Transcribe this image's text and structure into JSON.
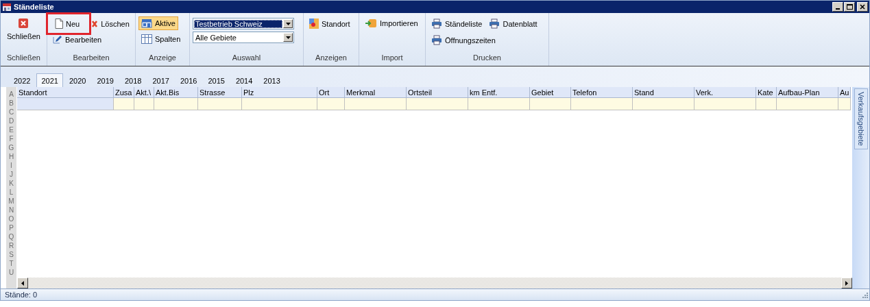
{
  "window": {
    "title": "Ständeliste"
  },
  "ribbon": {
    "groups": [
      {
        "label": "Schließen",
        "buttons": [
          {
            "label": "Schließen",
            "highlighted": false,
            "selected": false
          }
        ]
      },
      {
        "label": "Bearbeiten",
        "buttons": [
          {
            "label": "Neu",
            "highlighted": true,
            "selected": false
          },
          {
            "label": "Löschen",
            "highlighted": false,
            "selected": false
          },
          {
            "label": "Bearbeiten",
            "highlighted": false,
            "selected": false
          }
        ]
      },
      {
        "label": "Anzeige",
        "buttons": [
          {
            "label": "Aktive",
            "highlighted": false,
            "selected": true
          },
          {
            "label": "Spalten",
            "highlighted": false,
            "selected": false
          }
        ]
      },
      {
        "label": "Auswahl",
        "dropdowns": [
          {
            "value": "Testbetrieb Schweiz",
            "focused": true
          },
          {
            "value": "Alle Gebiete",
            "focused": false
          }
        ]
      },
      {
        "label": "Anzeigen",
        "buttons": [
          {
            "label": "Standort",
            "highlighted": false,
            "selected": false
          }
        ]
      },
      {
        "label": "Import",
        "buttons": [
          {
            "label": "Importieren",
            "highlighted": false,
            "selected": false
          }
        ]
      },
      {
        "label": "Drucken",
        "buttons": [
          {
            "label": "Ständeliste",
            "highlighted": false,
            "selected": false
          },
          {
            "label": "Datenblatt",
            "highlighted": false,
            "selected": false
          },
          {
            "label": "Öffnungszeiten",
            "highlighted": false,
            "selected": false
          }
        ]
      }
    ]
  },
  "year_tabs": [
    {
      "label": "2022",
      "selected": false
    },
    {
      "label": "2021",
      "selected": true
    },
    {
      "label": "2020",
      "selected": false
    },
    {
      "label": "2019",
      "selected": false
    },
    {
      "label": "2018",
      "selected": false
    },
    {
      "label": "2017",
      "selected": false
    },
    {
      "label": "2016",
      "selected": false
    },
    {
      "label": "2015",
      "selected": false
    },
    {
      "label": "2014",
      "selected": false
    },
    {
      "label": "2013",
      "selected": false
    }
  ],
  "row_letters": [
    "A",
    "B",
    "C",
    "D",
    "E",
    "F",
    "G",
    "H",
    "I",
    "J",
    "K",
    "L",
    "M",
    "N",
    "O",
    "P",
    "Q",
    "R",
    "S",
    "T",
    "U"
  ],
  "table": {
    "columns": [
      "Standort",
      "Zusa",
      "Akt.\\",
      "Akt.Bis",
      "Strasse",
      "Plz",
      "Ort",
      "Merkmal",
      "Ortsteil",
      "km Entf.",
      "Gebiet",
      "Telefon",
      "Stand",
      "Verk.",
      "Kate",
      "Aufbau-Plan",
      "Au"
    ]
  },
  "side_tab": {
    "label": "Verkaufsgebiete"
  },
  "status_bar": {
    "text": "Stände: 0"
  }
}
